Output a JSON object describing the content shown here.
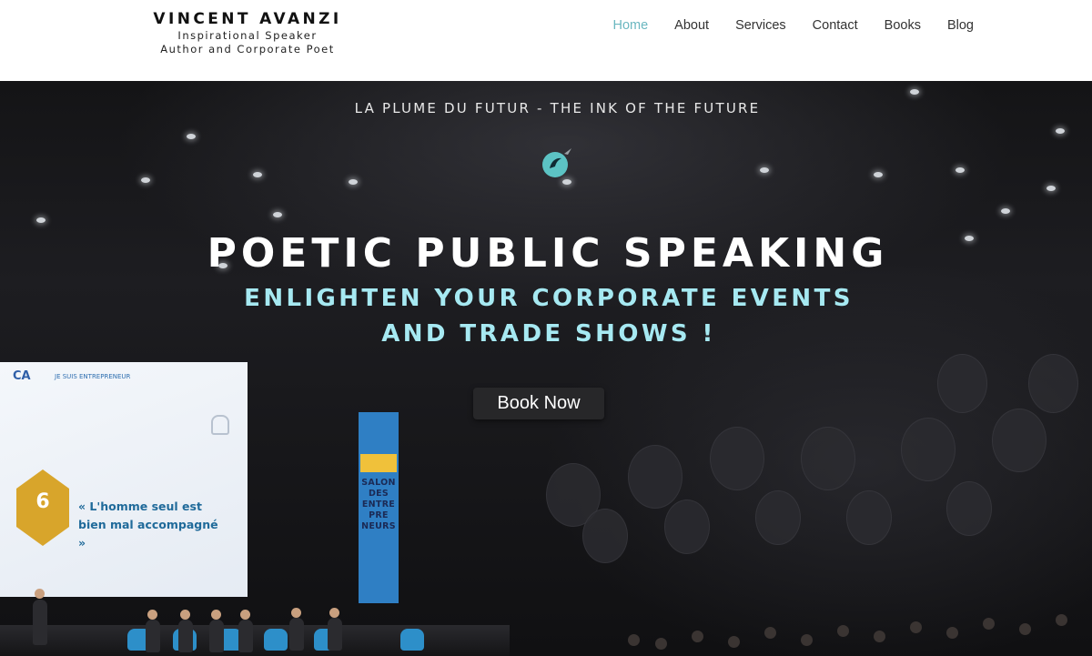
{
  "header": {
    "brand_name": "VINCENT AVANZI",
    "brand_line1": "Inspirational Speaker",
    "brand_line2": "Author and Corporate Poet",
    "nav": [
      {
        "label": "Home",
        "active": true
      },
      {
        "label": "About",
        "active": false
      },
      {
        "label": "Services",
        "active": false
      },
      {
        "label": "Contact",
        "active": false
      },
      {
        "label": "Books",
        "active": false
      },
      {
        "label": "Blog",
        "active": false
      }
    ]
  },
  "hero": {
    "tagline": "LA PLUME DU FUTUR - THE INK OF THE FUTURE",
    "headline": "POETIC PUBLIC SPEAKING",
    "subline1": "ENLIGHTEN YOUR CORPORATE EVENTS",
    "subline2": "AND TRADE SHOWS !",
    "cta_label": "Book Now",
    "screen_logo": "CA",
    "screen_logo_sub": "JE SUIS ENTREPRENEUR",
    "hexagon_number": "6",
    "screen_quote": "« L'homme seul est bien mal accompagné »",
    "banner_text": "SALON DES ENTRE PRE NEURS"
  },
  "colors": {
    "nav_active": "#6ab7c0",
    "subline": "#a6e9f2",
    "button_bg": "#272729",
    "quill_accent": "#5cc3c4"
  }
}
